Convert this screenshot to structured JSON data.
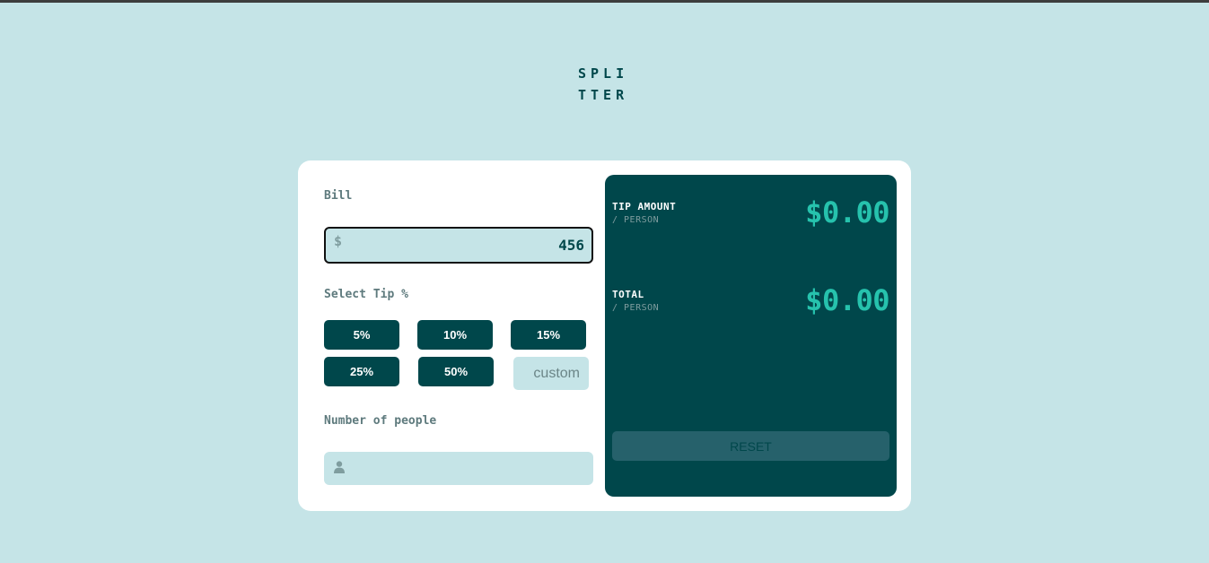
{
  "app": {
    "logo_line1": "SPLI",
    "logo_line2": "TTER"
  },
  "form": {
    "bill_label": "Bill",
    "bill_currency": "$",
    "bill_value": "456",
    "tip_label": "Select Tip %",
    "tip_options": [
      "5%",
      "10%",
      "15%",
      "25%",
      "50%"
    ],
    "custom_placeholder": "custom",
    "people_label": "Number of people",
    "people_value": ""
  },
  "results": {
    "tip_title": "TIP AMOUNT",
    "tip_sub": "/ PERSON",
    "tip_value": "$0.00",
    "total_title": "TOTAL",
    "total_sub": "/ PERSON",
    "total_value": "$0.00",
    "reset_label": "RESET"
  },
  "icons": {
    "bill": "dollar-icon",
    "people": "person-icon"
  },
  "colors": {
    "background": "#c5e4e7",
    "dark_cyan": "#00474b",
    "strong_cyan": "#26c2ad",
    "grayish_cyan": "#5e7a7d",
    "card": "#ffffff"
  }
}
